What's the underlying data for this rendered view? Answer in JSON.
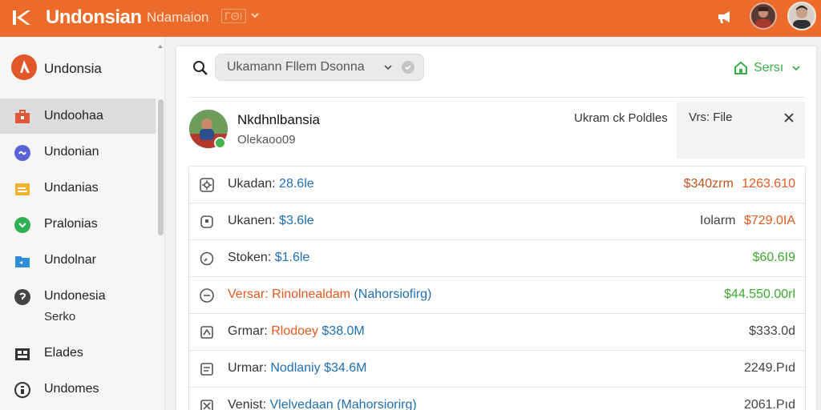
{
  "header": {
    "app_title": "Undonsian",
    "org_name": "Ndamaion",
    "org_badge": "ΓΘΙ",
    "colors": {
      "bar": "#ec6b2a",
      "title": "#ffffff"
    }
  },
  "sidebar": {
    "brand_label": "Undonsia",
    "items": [
      {
        "label": "Undoohaa",
        "icon": "briefcase-icon",
        "active": true
      },
      {
        "label": "Undonian",
        "icon": "link-icon"
      },
      {
        "label": "Undanias",
        "icon": "folder-icon"
      },
      {
        "label": "Pralonias",
        "icon": "chat-icon"
      },
      {
        "label": "Undolnar",
        "icon": "folder-icon"
      },
      {
        "label": "Undonesia",
        "label2": "Serko",
        "icon": "circle-icon"
      },
      {
        "label": "Elades",
        "icon": "grid-icon"
      },
      {
        "label": "Undomes",
        "icon": "info-icon"
      }
    ]
  },
  "toolbar": {
    "search_value": "Ukamann Fllem Dsonna",
    "share_label": "Sersı",
    "share_color": "#3cb04a"
  },
  "profile": {
    "name": "Nkdhnlbansia",
    "sub": "Olekaoo09",
    "link_label": "Ukram ck Poldles",
    "file_panel_label": "Vrs: File"
  },
  "rows": [
    {
      "label": "Ukadan:",
      "value": "28.6le",
      "value_color": "#1f6fb3",
      "label_color": "#333",
      "note": "$340zrm",
      "amount": "1263.610",
      "note_color": "#c0551f",
      "amount_color": "#e35a1f",
      "icon": "gear-icon"
    },
    {
      "label": "Ukanen:",
      "value": "$3.6le",
      "value_color": "#1f6fb3",
      "label_color": "#333",
      "note": "Iolarm",
      "amount": "$729.0IA",
      "note_color": "#444",
      "amount_color": "#e35a1f",
      "icon": "box-icon"
    },
    {
      "label": "Stoken:",
      "value": "$1.6le",
      "value_color": "#1f6fb3",
      "label_color": "#333",
      "note": "",
      "amount": "$60.6I9",
      "note_color": "#444",
      "amount_color": "#3caa2e",
      "icon": "clock-icon"
    },
    {
      "label": "Versar:",
      "value": "Rinolnealdam",
      "extra": "(Nahorsiofirg)",
      "value_color": "#e35a1f",
      "extra_color": "#1f6fb3",
      "label_color": "#e35a1f",
      "note": "",
      "amount": "$44.550.00rl",
      "note_color": "#444",
      "amount_color": "#3caa2e",
      "icon": "minus-circle-icon"
    },
    {
      "label": "Grmar:",
      "value": "Rlodoey",
      "extra": "$38.0M",
      "value_color": "#e35a1f",
      "extra_color": "#1f6fb3",
      "label_color": "#333",
      "note": "",
      "amount": "$333.0d",
      "note_color": "#444",
      "amount_color": "#444",
      "icon": "tag-icon"
    },
    {
      "label": "Urmar:",
      "value": "Nodlaniy",
      "extra": "$34.6M",
      "value_color": "#1f6fb3",
      "extra_color": "#1f6fb3",
      "label_color": "#333",
      "note": "",
      "amount": "2249.Pıd",
      "note_color": "#444",
      "amount_color": "#444",
      "icon": "doc-icon"
    },
    {
      "label": "Venist:",
      "value": "Vlelvedaan",
      "extra": "(Mahorsiorirg)",
      "value_color": "#1f6fb3",
      "extra_color": "#1f6fb3",
      "label_color": "#333",
      "note": "",
      "amount": "2061.Pıd",
      "note_color": "#444",
      "amount_color": "#444",
      "icon": "x-square-icon"
    }
  ]
}
